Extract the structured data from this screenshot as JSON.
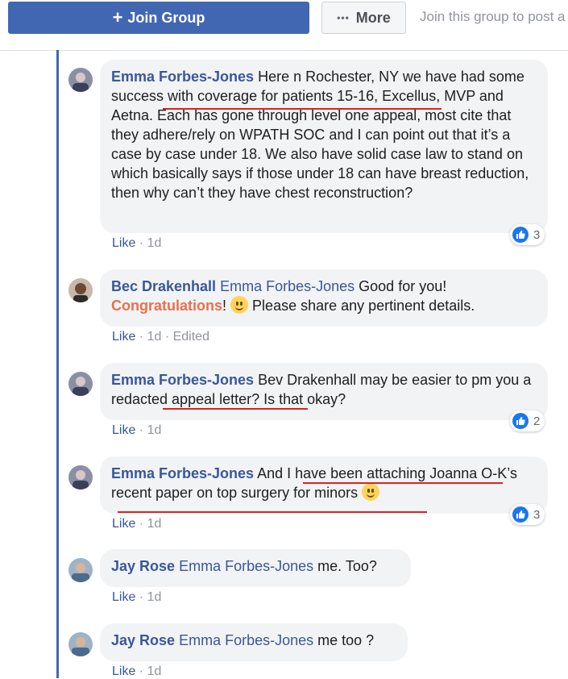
{
  "header": {
    "join_label": "Join Group",
    "more_label": "More",
    "hint": "Join this group to post a"
  },
  "comments": [
    {
      "author": "Emma Forbes-Jones",
      "text": "Here n Rochester, NY we have had some success with coverage for patients 15-16, Excellus, MVP and Aetna. Each has gone through level one appeal, most cite that they adhere/rely on WPATH SOC and I can point out that it’s a case by case under 18. We also have solid case law to stand on which basically says if those under 18 can have breast reduction, then why can’t they have chest reconstruction?",
      "like": "Like",
      "time": "1d",
      "reactions": "3"
    },
    {
      "author": "Bec Drakenhall",
      "mention": "Emma Forbes-Jones",
      "text_a": "Good for you!",
      "congrats": "Congratulations",
      "text_b": "!",
      "text_c": "Please share any pertinent details.",
      "like": "Like",
      "time": "1d",
      "edited": "Edited"
    },
    {
      "author": "Emma Forbes-Jones",
      "text": "Bev Drakenhall may be easier to pm you a redacted appeal letter? Is that okay?",
      "like": "Like",
      "time": "1d",
      "reactions": "2"
    },
    {
      "author": "Emma Forbes-Jones",
      "text": "And I have been attaching Joanna O-K’s recent paper on top surgery for minors",
      "like": "Like",
      "time": "1d",
      "reactions": "3"
    },
    {
      "author": "Jay Rose",
      "mention": "Emma Forbes-Jones",
      "text": "me. Too?",
      "like": "Like",
      "time": "1d"
    },
    {
      "author": "Jay Rose",
      "mention": "Emma Forbes-Jones",
      "text": "me too ?",
      "like": "Like",
      "time": "1d"
    }
  ],
  "colors": {
    "brand": "#4267b2",
    "link": "#385898",
    "congrats": "#e9704b",
    "annotation_underline": "#e02020"
  }
}
